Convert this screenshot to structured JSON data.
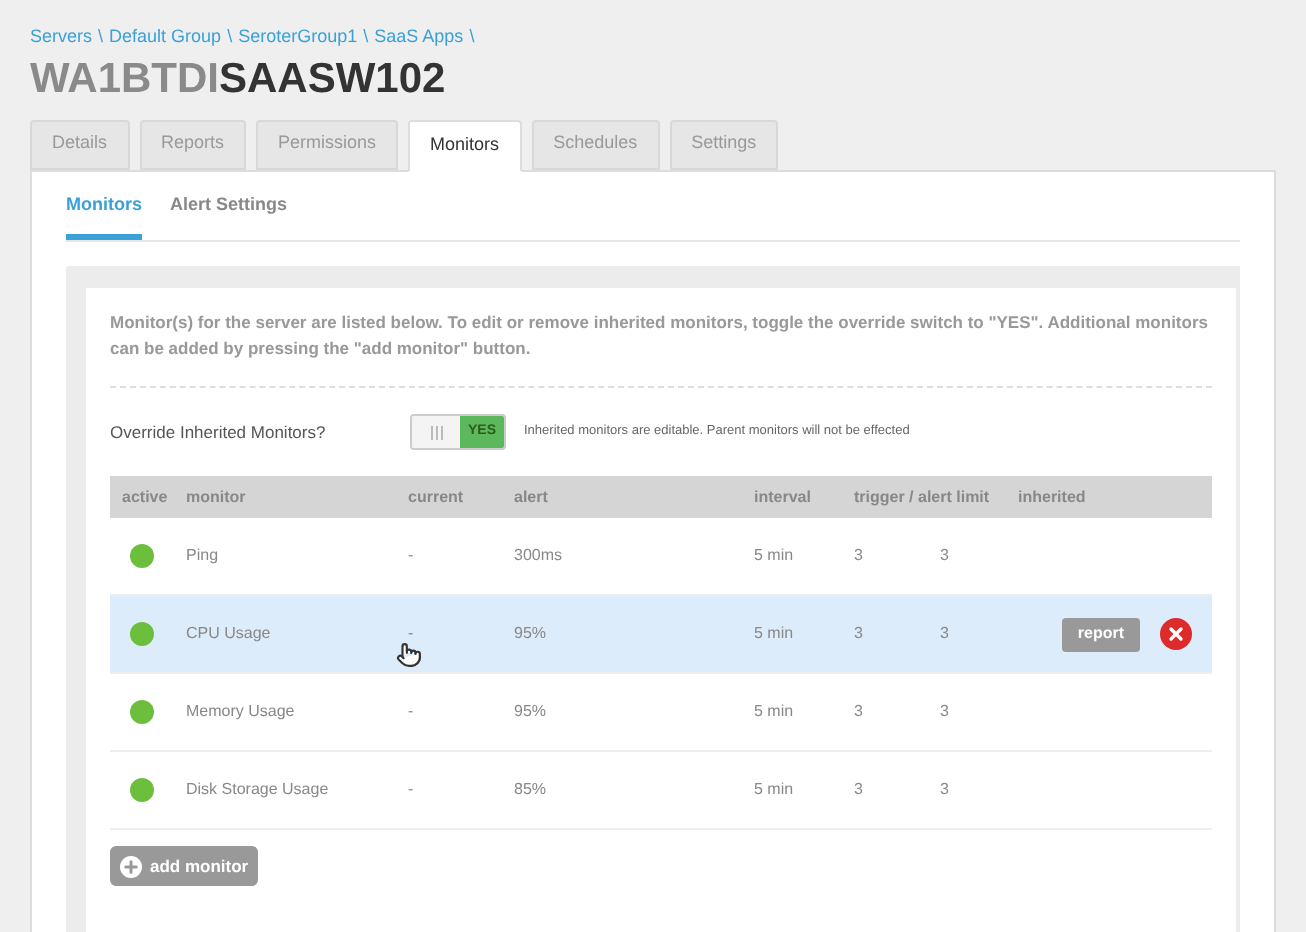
{
  "breadcrumb": [
    {
      "label": "Servers",
      "separator": "\\"
    },
    {
      "label": "Default Group",
      "separator": "\\"
    },
    {
      "label": "SeroterGroup1",
      "separator": "\\"
    },
    {
      "label": "SaaS Apps",
      "separator": "\\"
    }
  ],
  "title": {
    "prefix": "WA1BTDI",
    "name": "SAASW102"
  },
  "tabs": [
    {
      "label": "Details",
      "selected": false
    },
    {
      "label": "Reports",
      "selected": false
    },
    {
      "label": "Permissions",
      "selected": false
    },
    {
      "label": "Monitors",
      "selected": true
    },
    {
      "label": "Schedules",
      "selected": false
    },
    {
      "label": "Settings",
      "selected": false
    }
  ],
  "subtabs": [
    {
      "label": "Monitors",
      "selected": true
    },
    {
      "label": "Alert Settings",
      "selected": false
    }
  ],
  "intro": "Monitor(s) for the server are listed below. To edit or remove inherited monitors, toggle the override switch to \"YES\". Additional monitors can be added by pressing the \"add monitor\" button.",
  "override": {
    "label": "Override Inherited Monitors?",
    "on": true,
    "on_label": "YES",
    "note": "Inherited monitors are editable. Parent monitors will not be effected"
  },
  "table": {
    "columns": [
      "active",
      "monitor",
      "current",
      "alert",
      "interval",
      "trigger / alert limit",
      "inherited"
    ],
    "rows": [
      {
        "active": true,
        "monitor": "Ping",
        "current": "-",
        "alert": "300ms",
        "interval": "5 min",
        "trigger": "3",
        "alert_limit": "3",
        "selected": false
      },
      {
        "active": true,
        "monitor": "CPU Usage",
        "current": "-",
        "alert": "95%",
        "interval": "5 min",
        "trigger": "3",
        "alert_limit": "3",
        "selected": true
      },
      {
        "active": true,
        "monitor": "Memory Usage",
        "current": "-",
        "alert": "95%",
        "interval": "5 min",
        "trigger": "3",
        "alert_limit": "3",
        "selected": false
      },
      {
        "active": true,
        "monitor": "Disk Storage Usage",
        "current": "-",
        "alert": "85%",
        "interval": "5 min",
        "trigger": "3",
        "alert_limit": "3",
        "selected": false
      }
    ]
  },
  "row_actions": {
    "report": "report"
  },
  "add_button": "add monitor"
}
